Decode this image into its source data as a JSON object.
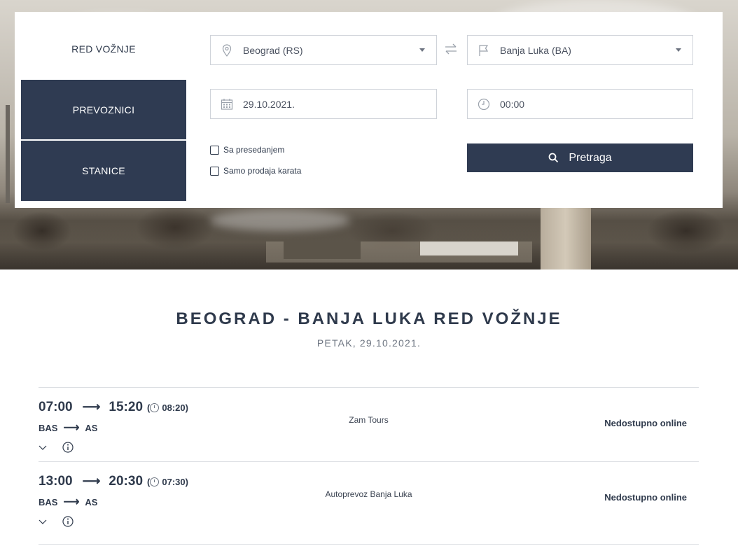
{
  "menu": {
    "timetable": "RED VOŽNJE",
    "carriers": "PREVOZNICI",
    "stations": "STANICE"
  },
  "search": {
    "from": "Beograd (RS)",
    "to": "Banja Luka (BA)",
    "date": "29.10.2021.",
    "time": "00:00",
    "with_transfer": "Sa presedanjem",
    "ticket_sales_only": "Samo prodaja karata",
    "search_button": "Pretraga",
    "icons": {
      "from": "location-pin-icon",
      "to": "flag-icon",
      "date": "calendar-icon",
      "time": "clock-icon",
      "swap": "swap-arrows-icon",
      "search": "search-icon"
    }
  },
  "results": {
    "title": "BEOGRAD - BANJA LUKA RED VOŽNJE",
    "subtitle": "PETAK, 29.10.2021.",
    "trips": [
      {
        "departure": "07:00",
        "arrival": "15:20",
        "duration": "08:20",
        "from_station": "BAS",
        "to_station": "AS",
        "carrier": "Zam Tours",
        "status": "Nedostupno online"
      },
      {
        "departure": "13:00",
        "arrival": "20:30",
        "duration": "07:30",
        "from_station": "BAS",
        "to_station": "AS",
        "carrier": "Autoprevoz Banja Luka",
        "status": "Nedostupno online"
      }
    ]
  },
  "colors": {
    "primary": "#2f3b52",
    "text": "#2f3a4c",
    "muted": "#6c7480",
    "border": "#cfd3d9"
  }
}
